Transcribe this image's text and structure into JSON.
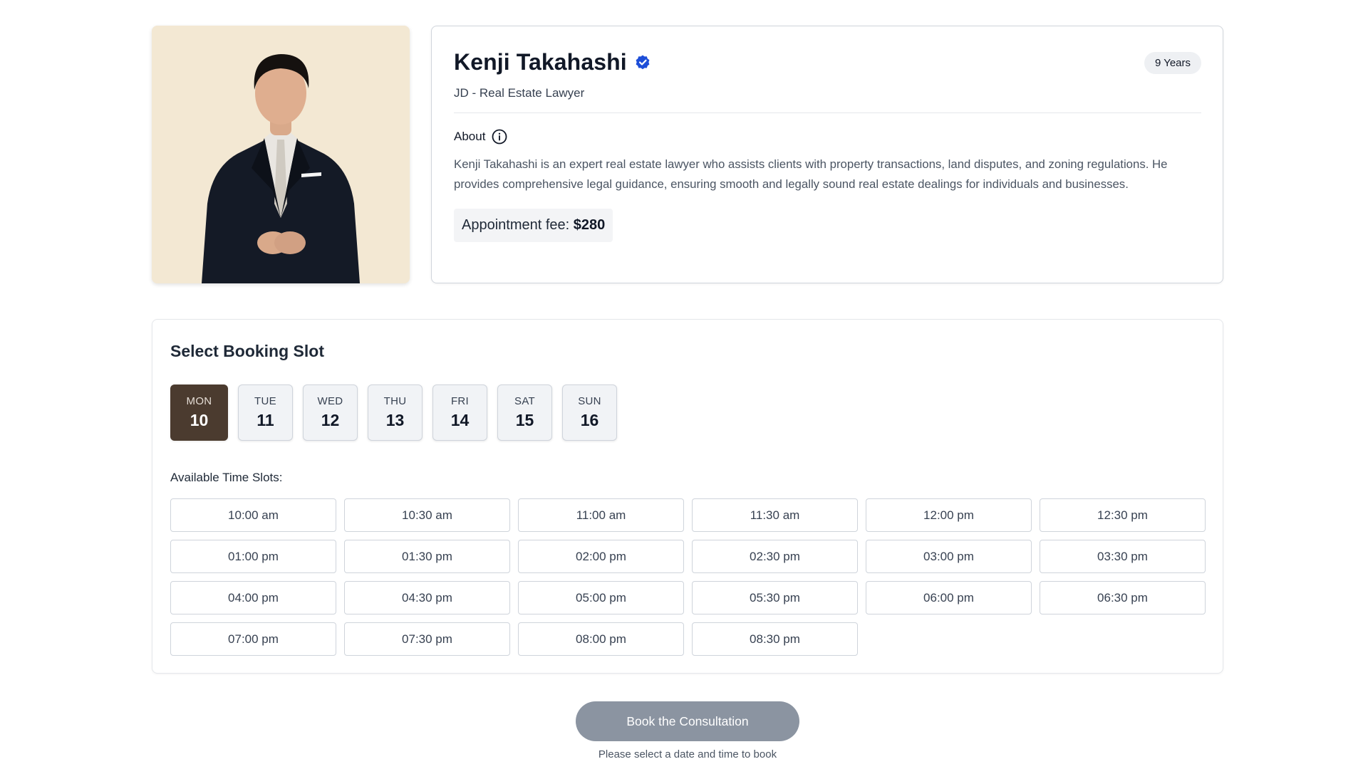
{
  "profile": {
    "name": "Kenji Takahashi",
    "verified_icon": "verified-badge-icon",
    "experience_badge": "9 Years",
    "title": "JD - Real Estate Lawyer",
    "about_label": "About",
    "about_icon": "info-icon",
    "about_text": "Kenji Takahashi is an expert real estate lawyer who assists clients with property transactions, land disputes, and zoning regulations. He provides comprehensive legal guidance, ensuring smooth and legally sound real estate dealings for individuals and businesses.",
    "fee_label": "Appointment fee:",
    "fee_value": "$280"
  },
  "booking": {
    "title": "Select Booking Slot",
    "days": [
      {
        "dow": "MON",
        "num": "10",
        "selected": true
      },
      {
        "dow": "TUE",
        "num": "11",
        "selected": false
      },
      {
        "dow": "WED",
        "num": "12",
        "selected": false
      },
      {
        "dow": "THU",
        "num": "13",
        "selected": false
      },
      {
        "dow": "FRI",
        "num": "14",
        "selected": false
      },
      {
        "dow": "SAT",
        "num": "15",
        "selected": false
      },
      {
        "dow": "SUN",
        "num": "16",
        "selected": false
      }
    ],
    "slots_label": "Available Time Slots:",
    "slots": [
      "10:00 am",
      "10:30 am",
      "11:00 am",
      "11:30 am",
      "12:00 pm",
      "12:30 pm",
      "01:00 pm",
      "01:30 pm",
      "02:00 pm",
      "02:30 pm",
      "03:00 pm",
      "03:30 pm",
      "04:00 pm",
      "04:30 pm",
      "05:00 pm",
      "05:30 pm",
      "06:00 pm",
      "06:30 pm",
      "07:00 pm",
      "07:30 pm",
      "08:00 pm",
      "08:30 pm"
    ]
  },
  "footer": {
    "book_button": "Book the Consultation",
    "hint": "Please select a date and time to book"
  },
  "colors": {
    "selected_day": "#4b3b2f",
    "button_disabled": "#8b94a1",
    "verified": "#1d4ed8",
    "photo_bg": "#f3e8d3"
  }
}
